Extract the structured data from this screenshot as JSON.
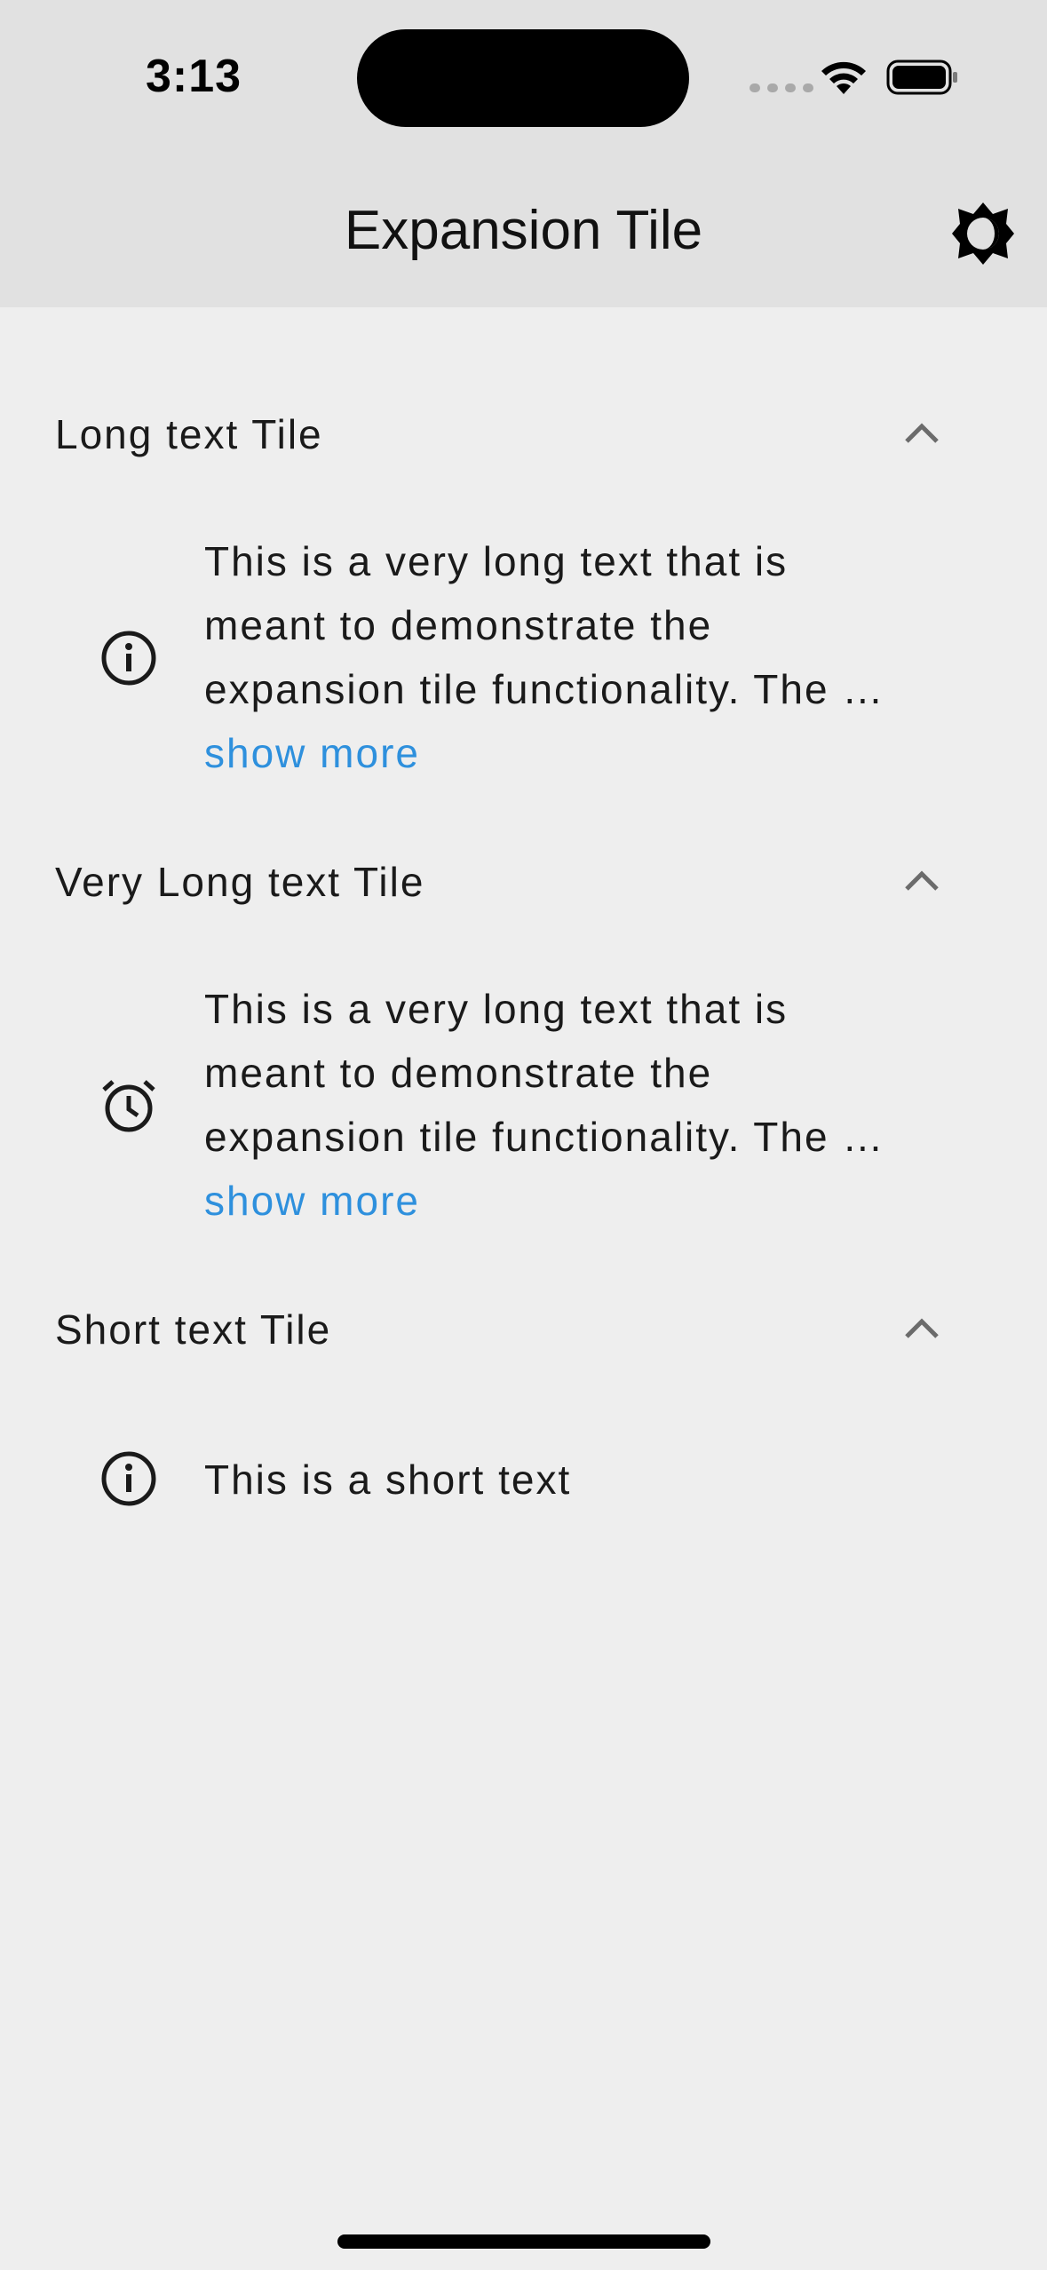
{
  "status_bar": {
    "time": "3:13"
  },
  "app_bar": {
    "title": "Expansion Tile",
    "theme_icon": "brightness-icon"
  },
  "tiles": [
    {
      "title": "Long text Tile",
      "expanded": true,
      "icon": "info-icon",
      "lines": [
        "This is a very long text that is",
        "meant to demonstrate the",
        "expansion tile functionality. The …"
      ],
      "show_more": "show more"
    },
    {
      "title": "Very Long text Tile",
      "expanded": true,
      "icon": "alarm-icon",
      "lines": [
        "This is a very long text that is",
        "meant to demonstrate the",
        "expansion tile functionality. The …"
      ],
      "show_more": "show more"
    },
    {
      "title": "Short text Tile",
      "expanded": true,
      "icon": "info-icon",
      "lines": [
        "This is a short text"
      ]
    }
  ],
  "colors": {
    "background": "#eeeeee",
    "app_bar": "#e1e1e1",
    "link": "#2e90dd",
    "chevron": "#6b6b6b"
  }
}
